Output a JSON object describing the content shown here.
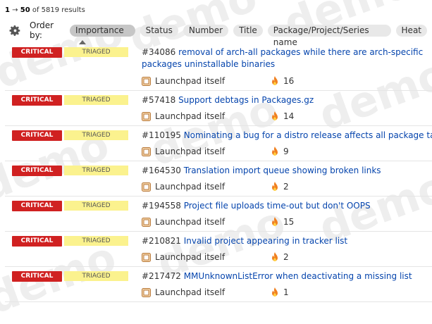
{
  "results": {
    "range_start": "1",
    "range_end": "50",
    "total_text": "of 5819 results"
  },
  "order": {
    "label": "Order by:",
    "options": [
      {
        "label": "Importance",
        "active": true
      },
      {
        "label": "Status"
      },
      {
        "label": "Number"
      },
      {
        "label": "Title"
      },
      {
        "label": "Package/Project/Series name"
      },
      {
        "label": "Heat"
      }
    ]
  },
  "watermark": "demo",
  "bugs": [
    {
      "importance": "CRITICAL",
      "status": "TRIAGED",
      "number": "#34086",
      "title": "removal of arch-all packages while there are arch-specific packages uninstallable binaries",
      "project": "Launchpad itself",
      "heat": "16"
    },
    {
      "importance": "CRITICAL",
      "status": "TRIAGED",
      "number": "#57418",
      "title": "Support debtags in Packages.gz",
      "project": "Launchpad itself",
      "heat": "14"
    },
    {
      "importance": "CRITICAL",
      "status": "TRIAGED",
      "number": "#110195",
      "title": "Nominating a bug for a distro release affects all package tasks for th",
      "project": "Launchpad itself",
      "heat": "9"
    },
    {
      "importance": "CRITICAL",
      "status": "TRIAGED",
      "number": "#164530",
      "title": "Translation import queue showing broken links",
      "project": "Launchpad itself",
      "heat": "2"
    },
    {
      "importance": "CRITICAL",
      "status": "TRIAGED",
      "number": "#194558",
      "title": "Project file uploads time-out but don't OOPS",
      "project": "Launchpad itself",
      "heat": "15"
    },
    {
      "importance": "CRITICAL",
      "status": "TRIAGED",
      "number": "#210821",
      "title": "Invalid project appearing in tracker list",
      "project": "Launchpad itself",
      "heat": "2"
    },
    {
      "importance": "CRITICAL",
      "status": "TRIAGED",
      "number": "#217472",
      "title": "MMUnknownListError when deactivating a missing list",
      "project": "Launchpad itself",
      "heat": "1"
    }
  ],
  "colors": {
    "critical": "#d02121",
    "triaged": "#fbf28e",
    "link": "#0645ad"
  }
}
